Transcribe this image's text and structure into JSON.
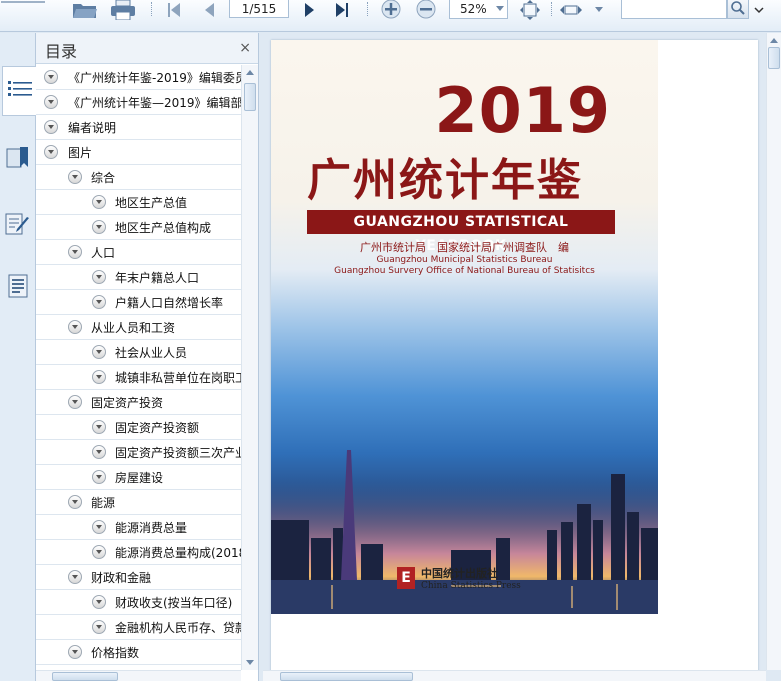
{
  "toolbar": {
    "page_field": "1/515",
    "zoom_value": "52%",
    "search_placeholder": ""
  },
  "panel": {
    "title": "目录",
    "close_glyph": "×"
  },
  "outline": [
    {
      "label": "《广州统计年鉴-2019》编辑委员",
      "level": 0
    },
    {
      "label": "《广州统计年鉴—2019》编辑部",
      "level": 0
    },
    {
      "label": "编者说明",
      "level": 0
    },
    {
      "label": "图片",
      "level": 0
    },
    {
      "label": "综合",
      "level": 1
    },
    {
      "label": "地区生产总值",
      "level": 2
    },
    {
      "label": "地区生产总值构成",
      "level": 2
    },
    {
      "label": "人口",
      "level": 1
    },
    {
      "label": "年末户籍总人口",
      "level": 2
    },
    {
      "label": "户籍人口自然增长率",
      "level": 2
    },
    {
      "label": "从业人员和工资",
      "level": 1
    },
    {
      "label": "社会从业人员",
      "level": 2
    },
    {
      "label": "城镇非私营单位在岗职工",
      "level": 2
    },
    {
      "label": "固定资产投资",
      "level": 1
    },
    {
      "label": "固定资产投资额",
      "level": 2
    },
    {
      "label": "固定资产投资额三次产业",
      "level": 2
    },
    {
      "label": "房屋建设",
      "level": 2
    },
    {
      "label": "能源",
      "level": 1
    },
    {
      "label": "能源消费总量",
      "level": 2
    },
    {
      "label": "能源消费总量构成(2018",
      "level": 2
    },
    {
      "label": "财政和金融",
      "level": 1
    },
    {
      "label": "财政收支(按当年口径)",
      "level": 2
    },
    {
      "label": "金融机构人民币存、贷款",
      "level": 2
    },
    {
      "label": "价格指数",
      "level": 1
    }
  ],
  "cover": {
    "year": "2019",
    "title_cn": "广州统计年鉴",
    "title_en": "GUANGZHOU STATISTICAL YEARBOOK",
    "publisher_line": "广州市统计局　国家统计局广州调查队　编",
    "publisher_en_1": "Guangzhou Municipal Statistics Bureau",
    "publisher_en_2": "Guangzhou Survery Office of National Bureau of Statisitcs",
    "press_logo_glyph": "E",
    "press_cn": "中国统计出版社",
    "press_en": "China Statistics Press"
  },
  "colors": {
    "accent": "#8b1717",
    "toolbar_icon": "#4f6e92"
  }
}
